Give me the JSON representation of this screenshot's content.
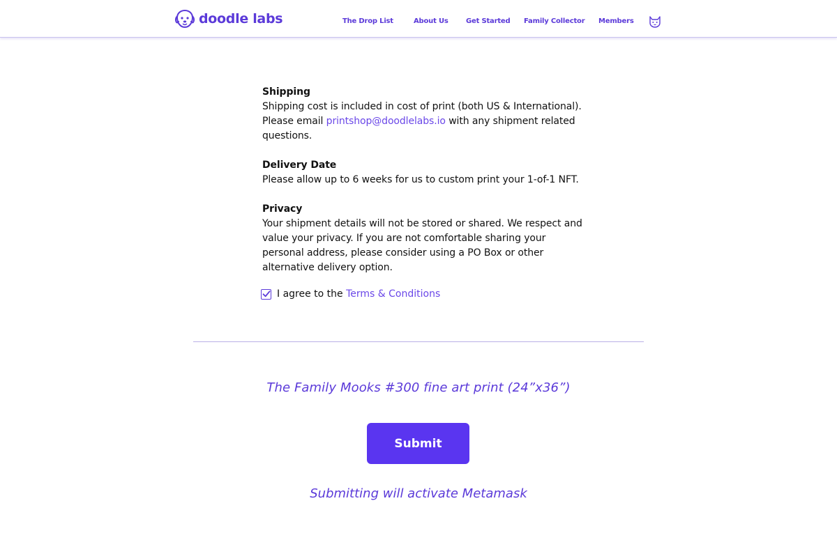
{
  "brand": {
    "name": "doodle labs",
    "accent_color": "#5b3ad9",
    "button_color": "#5a35f0"
  },
  "nav": {
    "items": [
      "The Drop List",
      "About Us",
      "Get Started",
      "Family Collector",
      "Members"
    ],
    "profile_icon": "doodle-cat-icon"
  },
  "shipping": {
    "title": "Shipping",
    "line1": "Shipping cost is included in cost of print (both US & International).",
    "before_email": "Please email ",
    "email": "printshop@doodlelabs.io",
    "after_email": " with any shipment related questions."
  },
  "delivery": {
    "title": "Delivery Date",
    "text": "Please allow up to 6 weeks for us to custom print your 1-of-1 NFT."
  },
  "privacy": {
    "title": "Privacy",
    "text": "Your shipment details will not be stored or shared. We respect and value your privacy. If you are not comfortable sharing your personal address, please consider using a PO Box  or other alternative delivery option."
  },
  "agreement": {
    "checked": true,
    "prefix": "I agree to the ",
    "link": "Terms & Conditions"
  },
  "product": {
    "title": "The Family Mooks #300 fine art print (24”x36”)"
  },
  "submit": {
    "label": "Submit"
  },
  "note": "Submitting will activate Metamask"
}
